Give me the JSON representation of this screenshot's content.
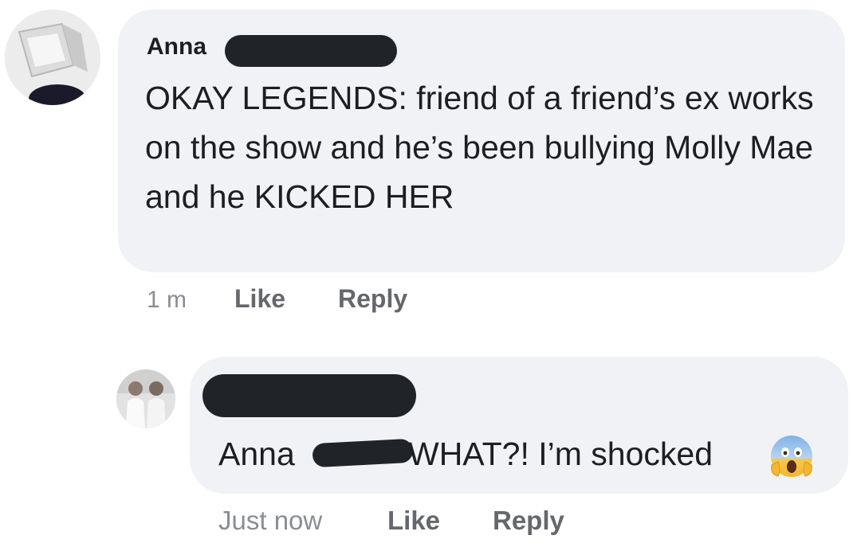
{
  "comments": [
    {
      "author": "Anna",
      "author_surname_redacted": true,
      "avatar_icon": "crt-monitor-avatar-icon",
      "text": "OKAY LEGENDS: friend of a friend’s ex works on the show and he’s been bullying Molly Mae and he KICKED HER",
      "timestamp": "1 m",
      "like_label": "Like",
      "reply_label": "Reply"
    },
    {
      "author_redacted": true,
      "avatar_icon": "two-people-photo-avatar-icon",
      "mention": "Anna",
      "text": "WHAT?! I’m shocked",
      "emoji": "face-screaming-in-fear",
      "timestamp": "Just now",
      "like_label": "Like",
      "reply_label": "Reply"
    }
  ],
  "colors": {
    "bubble_bg": "#f0f2f5",
    "redaction": "#202428",
    "text_primary": "#1c1e21",
    "text_secondary": "#65676b",
    "timestamp": "#8a8d91"
  }
}
